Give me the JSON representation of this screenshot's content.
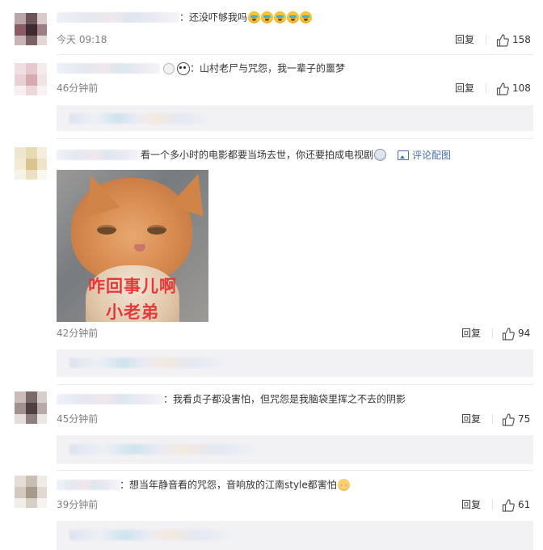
{
  "comments": [
    {
      "text": "：还没吓够我吗",
      "emojis": [
        "cry-laugh-emoji",
        "cry-laugh-emoji",
        "cry-laugh-emoji",
        "cry-laugh-emoji",
        "cry-laugh-emoji"
      ],
      "time": "今天 09:18",
      "reply_label": "回复",
      "likes": "158"
    },
    {
      "text": "：山村老尸与咒怨，我一辈子的噩梦",
      "badges": [
        "medal-icon",
        "panda-icon"
      ],
      "time": "46分钟前",
      "reply_label": "回复",
      "likes": "108",
      "sub_reply_partial": "…80"
    },
    {
      "text": "看一个多小时的电影都要当场去世，你还要拍成电视剧",
      "emojis": [
        "shock-emoji"
      ],
      "pic_link": "评论配图",
      "image_caption_line1": "咋回事儿啊",
      "image_caption_line2": "小老弟",
      "time": "42分钟前",
      "reply_label": "回复",
      "likes": "94"
    },
    {
      "text": "：我看贞子都没害怕，但咒怨是我脑袋里挥之不去的阴影",
      "time": "45分钟前",
      "reply_label": "回复",
      "likes": "75"
    },
    {
      "text": "：想当年静音看的咒怨，音响放的江南style都害怕",
      "emojis": [
        "shy-emoji"
      ],
      "time": "39分钟前",
      "reply_label": "回复",
      "likes": "61"
    }
  ],
  "colors": {
    "meta_gray": "#808080",
    "link_blue": "#4a6fa5",
    "sub_reply_bg": "#f2f2f5",
    "caption_red": "#e23a3a"
  }
}
